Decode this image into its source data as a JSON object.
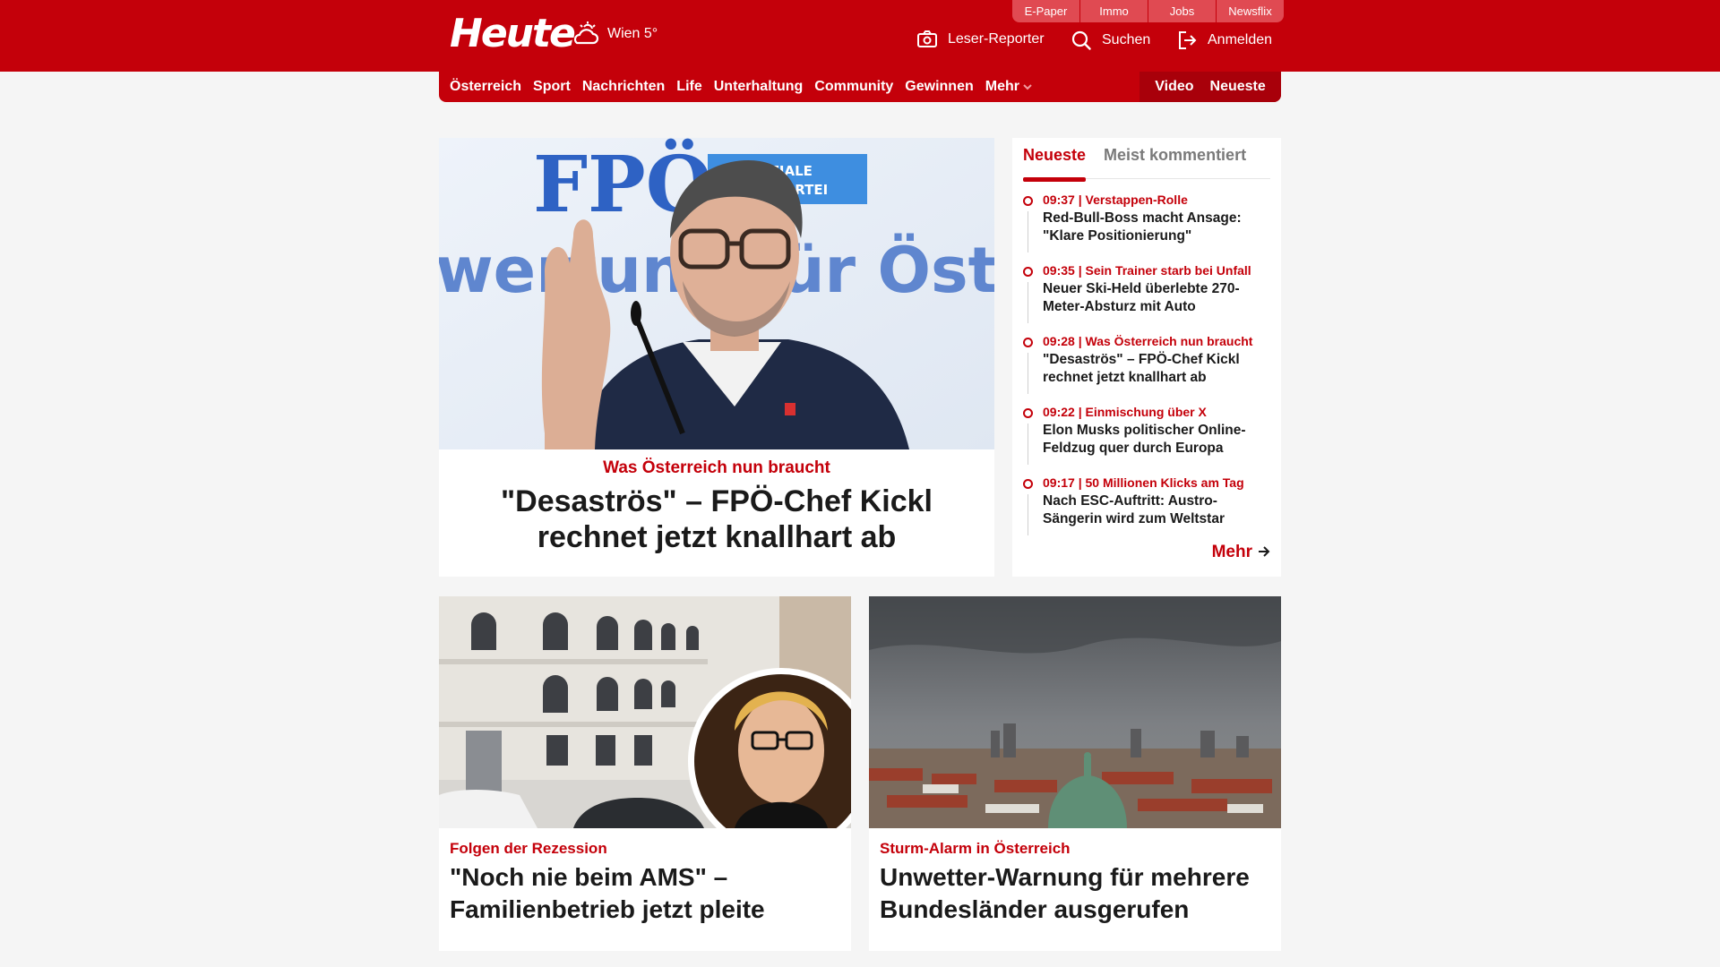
{
  "brand": {
    "logo": "Heute"
  },
  "weather": {
    "text": "Wien 5°",
    "icon": "cloud-sun-icon"
  },
  "toplinks": [
    "E-Paper",
    "Immo",
    "Jobs",
    "Newsflix"
  ],
  "header_actions": {
    "reporter": "Leser-Reporter",
    "search": "Suchen",
    "login": "Anmelden"
  },
  "nav": {
    "items": [
      "Österreich",
      "Sport",
      "Nachrichten",
      "Life",
      "Unterhaltung",
      "Community",
      "Gewinnen"
    ],
    "more": "Mehr",
    "video": "Video",
    "latest": "Neueste"
  },
  "hero": {
    "kicker": "Was Österreich nun braucht",
    "title": "\"Desaströs\" – FPÖ-Chef Kickl rechnet jetzt knallhart ab",
    "image_sign_party": "FPÖ",
    "image_sign_claim": "DIE SOZIALE HEIMATPARTEI",
    "image_sign_slogan": "wertung für Öste"
  },
  "sidebar": {
    "tabs": [
      "Neueste",
      "Meist kommentiert"
    ],
    "items": [
      {
        "meta": "09:37 | Verstappen-Rolle",
        "title": "Red-Bull-Boss macht Ansage: \"Klare Positionierung\""
      },
      {
        "meta": "09:35 | Sein Trainer starb bei Unfall",
        "title": "Neuer Ski-Held überlebte 270-Meter-Absturz mit Auto"
      },
      {
        "meta": "09:28 | Was Österreich nun braucht",
        "title": "\"Desaströs\" – FPÖ-Chef Kickl rechnet jetzt knallhart ab"
      },
      {
        "meta": "09:22 | Einmischung über X",
        "title": "Elon Musks politischer Online-Feldzug quer durch Europa"
      },
      {
        "meta": "09:17 | 50 Millionen Klicks am Tag",
        "title": "Nach ESC-Auftritt: Austro-Sängerin wird zum Weltstar"
      }
    ],
    "more": "Mehr"
  },
  "cards": [
    {
      "kicker": "Folgen der Rezession",
      "title": "\"Noch nie beim AMS\" – Familienbetrieb jetzt pleite"
    },
    {
      "kicker": "Sturm-Alarm in Österreich",
      "title": "Unwetter-Warnung für mehrere Bundesländer ausgerufen"
    }
  ],
  "colors": {
    "brand_red": "#c4000a",
    "nav_dark": "#a8000a",
    "background": "#f5f5f5"
  }
}
